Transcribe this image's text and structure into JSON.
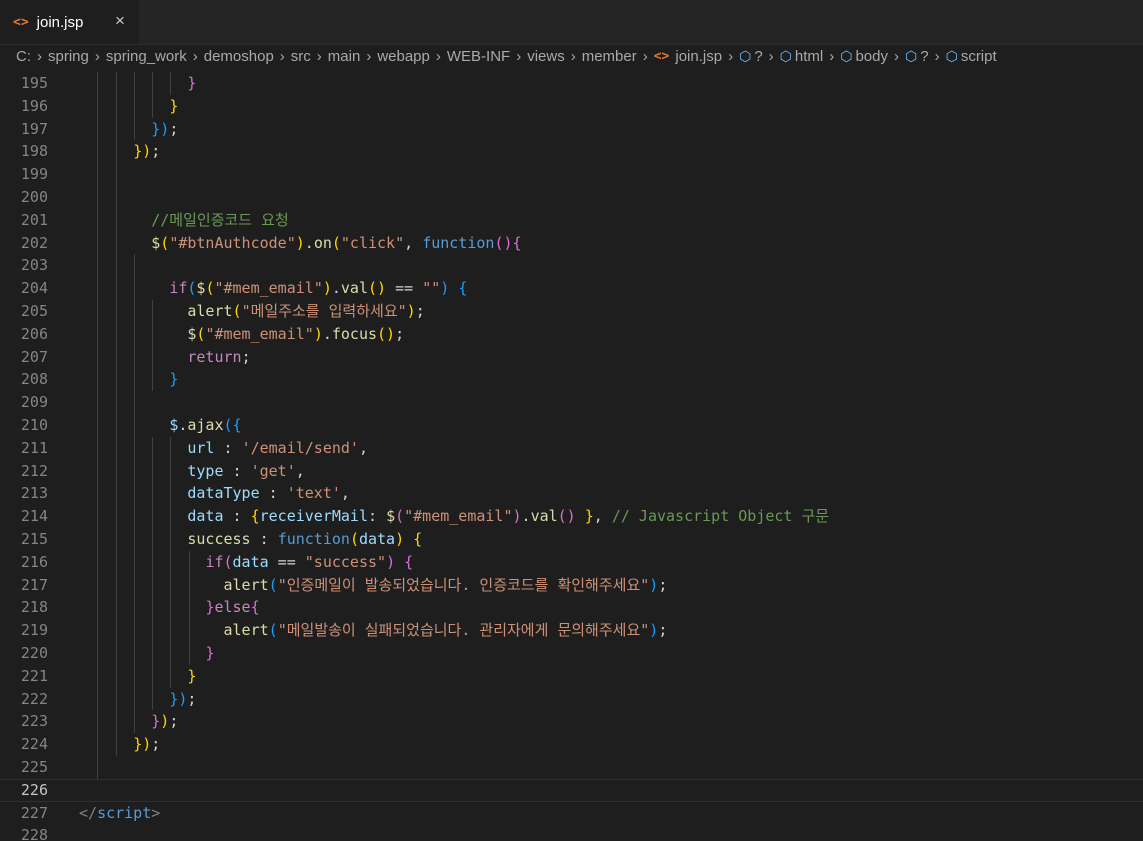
{
  "tab": {
    "file_icon": "<>",
    "label": "join.jsp",
    "close": "×"
  },
  "breadcrumbs": [
    "C:",
    "spring",
    "spring_work",
    "demoshop",
    "src",
    "main",
    "webapp",
    "WEB-INF",
    "views",
    "member",
    "join.jsp",
    "?",
    "html",
    "body",
    "?",
    "script"
  ],
  "colors": {
    "background": "#1e1e1e",
    "comment": "#6a9955",
    "string": "#ce9178",
    "keyword": "#569cd6",
    "control": "#c586c0",
    "function": "#dcdcaa",
    "property": "#9cdcfe",
    "bracket1": "#ffd700",
    "bracket2": "#da70d6",
    "bracket3": "#179fff"
  },
  "editor": {
    "current_line": "226",
    "lines": [
      {
        "n": "195",
        "t": [
          [
            "            ",
            ""
          ],
          [
            "}",
            "b2"
          ]
        ]
      },
      {
        "n": "196",
        "t": [
          [
            "          ",
            ""
          ],
          [
            "}",
            "b1"
          ]
        ]
      },
      {
        "n": "197",
        "t": [
          [
            "        ",
            ""
          ],
          [
            "}",
            "b3"
          ],
          [
            ")",
            "b3"
          ],
          [
            ";",
            "pn"
          ]
        ]
      },
      {
        "n": "198",
        "t": [
          [
            "      ",
            ""
          ],
          [
            "}",
            "b1"
          ],
          [
            ")",
            "b1"
          ],
          [
            ";",
            "pn"
          ]
        ]
      },
      {
        "n": "199",
        "t": []
      },
      {
        "n": "200",
        "t": []
      },
      {
        "n": "201",
        "t": [
          [
            "        ",
            ""
          ],
          [
            "//메일인증코드 요청",
            "cm"
          ]
        ]
      },
      {
        "n": "202",
        "t": [
          [
            "        ",
            ""
          ],
          [
            "$",
            "fn"
          ],
          [
            "(",
            "b1"
          ],
          [
            "\"#btnAuthcode\"",
            "st"
          ],
          [
            ")",
            "b1"
          ],
          [
            ".",
            "pn"
          ],
          [
            "on",
            "fn"
          ],
          [
            "(",
            "b1"
          ],
          [
            "\"click\"",
            "st"
          ],
          [
            ", ",
            "pn"
          ],
          [
            "function",
            "kw"
          ],
          [
            "()",
            "b2"
          ],
          [
            "{",
            "b2"
          ]
        ]
      },
      {
        "n": "203",
        "t": []
      },
      {
        "n": "204",
        "t": [
          [
            "          ",
            ""
          ],
          [
            "if",
            "cf"
          ],
          [
            "(",
            "b3"
          ],
          [
            "$",
            "fn"
          ],
          [
            "(",
            "b1"
          ],
          [
            "\"#mem_email\"",
            "st"
          ],
          [
            ")",
            "b1"
          ],
          [
            ".",
            "pn"
          ],
          [
            "val",
            "fn"
          ],
          [
            "()",
            "b1"
          ],
          [
            " == ",
            "pn"
          ],
          [
            "\"\"",
            "st"
          ],
          [
            ")",
            "b3"
          ],
          [
            " ",
            "pn"
          ],
          [
            "{",
            "b3"
          ]
        ]
      },
      {
        "n": "205",
        "t": [
          [
            "            ",
            ""
          ],
          [
            "alert",
            "fn"
          ],
          [
            "(",
            "b1"
          ],
          [
            "\"메일주소를 입력하세요\"",
            "st"
          ],
          [
            ")",
            "b1"
          ],
          [
            ";",
            "pn"
          ]
        ]
      },
      {
        "n": "206",
        "t": [
          [
            "            ",
            ""
          ],
          [
            "$",
            "fn"
          ],
          [
            "(",
            "b1"
          ],
          [
            "\"#mem_email\"",
            "st"
          ],
          [
            ")",
            "b1"
          ],
          [
            ".",
            "pn"
          ],
          [
            "focus",
            "fn"
          ],
          [
            "()",
            "b1"
          ],
          [
            ";",
            "pn"
          ]
        ]
      },
      {
        "n": "207",
        "t": [
          [
            "            ",
            ""
          ],
          [
            "return",
            "cf"
          ],
          [
            ";",
            "pn"
          ]
        ]
      },
      {
        "n": "208",
        "t": [
          [
            "          ",
            ""
          ],
          [
            "}",
            "b3"
          ]
        ]
      },
      {
        "n": "209",
        "t": []
      },
      {
        "n": "210",
        "t": [
          [
            "          ",
            ""
          ],
          [
            "$",
            "pr"
          ],
          [
            ".",
            "pn"
          ],
          [
            "ajax",
            "fn"
          ],
          [
            "(",
            "b3"
          ],
          [
            "{",
            "b3"
          ]
        ]
      },
      {
        "n": "211",
        "t": [
          [
            "            ",
            ""
          ],
          [
            "url",
            "pr"
          ],
          [
            " : ",
            "pn"
          ],
          [
            "'/email/send'",
            "st"
          ],
          [
            ",",
            "pn"
          ]
        ]
      },
      {
        "n": "212",
        "t": [
          [
            "            ",
            ""
          ],
          [
            "type",
            "pr"
          ],
          [
            " : ",
            "pn"
          ],
          [
            "'get'",
            "st"
          ],
          [
            ",",
            "pn"
          ]
        ]
      },
      {
        "n": "213",
        "t": [
          [
            "            ",
            ""
          ],
          [
            "dataType",
            "pr"
          ],
          [
            " : ",
            "pn"
          ],
          [
            "'text'",
            "st"
          ],
          [
            ",",
            "pn"
          ]
        ]
      },
      {
        "n": "214",
        "t": [
          [
            "            ",
            ""
          ],
          [
            "data",
            "pr"
          ],
          [
            " : ",
            "pn"
          ],
          [
            "{",
            "b1"
          ],
          [
            "receiverMail",
            "pr"
          ],
          [
            ": ",
            "pn"
          ],
          [
            "$",
            "fn"
          ],
          [
            "(",
            "b2"
          ],
          [
            "\"#mem_email\"",
            "st"
          ],
          [
            ")",
            "b2"
          ],
          [
            ".",
            "pn"
          ],
          [
            "val",
            "fn"
          ],
          [
            "()",
            "b2"
          ],
          [
            " ",
            "pn"
          ],
          [
            "}",
            "b1"
          ],
          [
            ", ",
            "pn"
          ],
          [
            "// Javascript Object 구문",
            "cm"
          ]
        ]
      },
      {
        "n": "215",
        "t": [
          [
            "            ",
            ""
          ],
          [
            "success",
            "fn"
          ],
          [
            " : ",
            "pn"
          ],
          [
            "function",
            "kw"
          ],
          [
            "(",
            "b1"
          ],
          [
            "data",
            "pr"
          ],
          [
            ")",
            "b1"
          ],
          [
            " ",
            "pn"
          ],
          [
            "{",
            "b1"
          ]
        ]
      },
      {
        "n": "216",
        "t": [
          [
            "              ",
            ""
          ],
          [
            "if",
            "cf"
          ],
          [
            "(",
            "b2"
          ],
          [
            "data",
            "pr"
          ],
          [
            " == ",
            "pn"
          ],
          [
            "\"success\"",
            "st"
          ],
          [
            ")",
            "b2"
          ],
          [
            " ",
            "pn"
          ],
          [
            "{",
            "b2"
          ]
        ]
      },
      {
        "n": "217",
        "t": [
          [
            "                ",
            ""
          ],
          [
            "alert",
            "fn"
          ],
          [
            "(",
            "b3"
          ],
          [
            "\"인증메일이 발송되었습니다. 인증코드를 확인해주세요\"",
            "st"
          ],
          [
            ")",
            "b3"
          ],
          [
            ";",
            "pn"
          ]
        ]
      },
      {
        "n": "218",
        "t": [
          [
            "              ",
            ""
          ],
          [
            "}",
            "b2"
          ],
          [
            "else",
            "cf"
          ],
          [
            "{",
            "b2"
          ]
        ]
      },
      {
        "n": "219",
        "t": [
          [
            "                ",
            ""
          ],
          [
            "alert",
            "fn"
          ],
          [
            "(",
            "b3"
          ],
          [
            "\"메일발송이 실패되었습니다. 관리자에게 문의해주세요\"",
            "st"
          ],
          [
            ")",
            "b3"
          ],
          [
            ";",
            "pn"
          ]
        ]
      },
      {
        "n": "220",
        "t": [
          [
            "              ",
            ""
          ],
          [
            "}",
            "b2"
          ]
        ]
      },
      {
        "n": "221",
        "t": [
          [
            "            ",
            ""
          ],
          [
            "}",
            "b1"
          ]
        ]
      },
      {
        "n": "222",
        "t": [
          [
            "          ",
            ""
          ],
          [
            "}",
            "b3"
          ],
          [
            ")",
            "b3"
          ],
          [
            ";",
            "pn"
          ]
        ]
      },
      {
        "n": "223",
        "t": [
          [
            "        ",
            ""
          ],
          [
            "}",
            "b2"
          ],
          [
            ")",
            "b1"
          ],
          [
            ";",
            "pn"
          ]
        ]
      },
      {
        "n": "224",
        "t": [
          [
            "      ",
            ""
          ],
          [
            "}",
            "b1"
          ],
          [
            ")",
            "b1"
          ],
          [
            ";",
            "pn"
          ]
        ]
      },
      {
        "n": "225",
        "t": []
      },
      {
        "n": "226",
        "t": []
      },
      {
        "n": "227",
        "t": [
          [
            "</",
            "tgp"
          ],
          [
            "script",
            "tg"
          ],
          [
            ">",
            "tgp"
          ]
        ]
      },
      {
        "n": "228",
        "t": []
      }
    ]
  }
}
